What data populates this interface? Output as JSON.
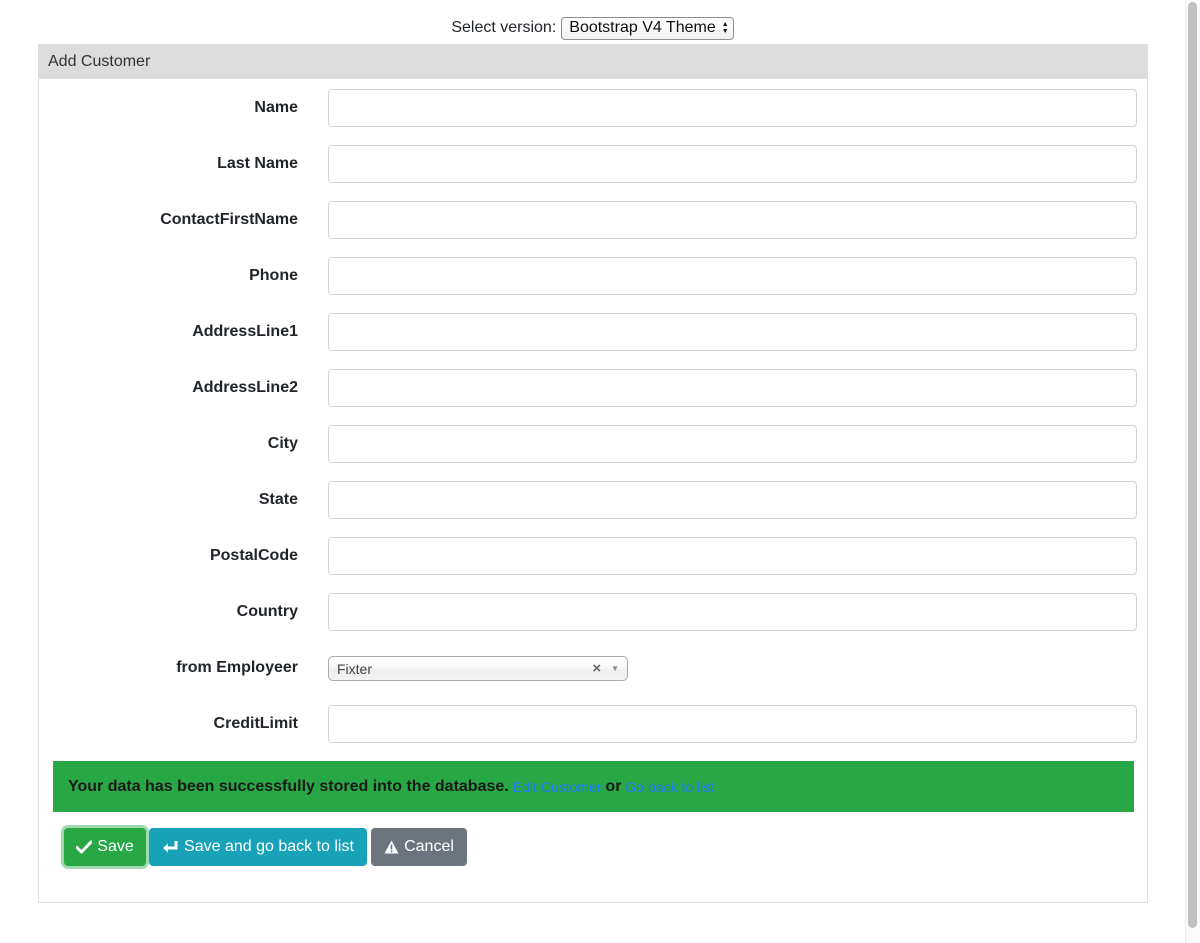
{
  "version_selector": {
    "label": "Select version:",
    "selected": "Bootstrap V4 Theme"
  },
  "panel": {
    "title": "Add Customer"
  },
  "fields": [
    {
      "label": "Name",
      "value": ""
    },
    {
      "label": "Last Name",
      "value": ""
    },
    {
      "label": "ContactFirstName",
      "value": ""
    },
    {
      "label": "Phone",
      "value": ""
    },
    {
      "label": "AddressLine1",
      "value": ""
    },
    {
      "label": "AddressLine2",
      "value": ""
    },
    {
      "label": "City",
      "value": ""
    },
    {
      "label": "State",
      "value": ""
    },
    {
      "label": "PostalCode",
      "value": ""
    },
    {
      "label": "Country",
      "value": ""
    },
    {
      "label": "from Employeer",
      "value": "Fixter"
    },
    {
      "label": "CreditLimit",
      "value": ""
    }
  ],
  "alert": {
    "message": "Your data has been successfully stored into the database.",
    "edit_link": "Edit Customer",
    "separator": "or",
    "back_link": "Go back to list"
  },
  "buttons": {
    "save": "Save",
    "save_back": "Save and go back to list",
    "cancel": "Cancel"
  },
  "colors": {
    "success": "#28a745",
    "info": "#17a2b8",
    "secondary": "#6c757d",
    "link": "#1a7cff"
  }
}
